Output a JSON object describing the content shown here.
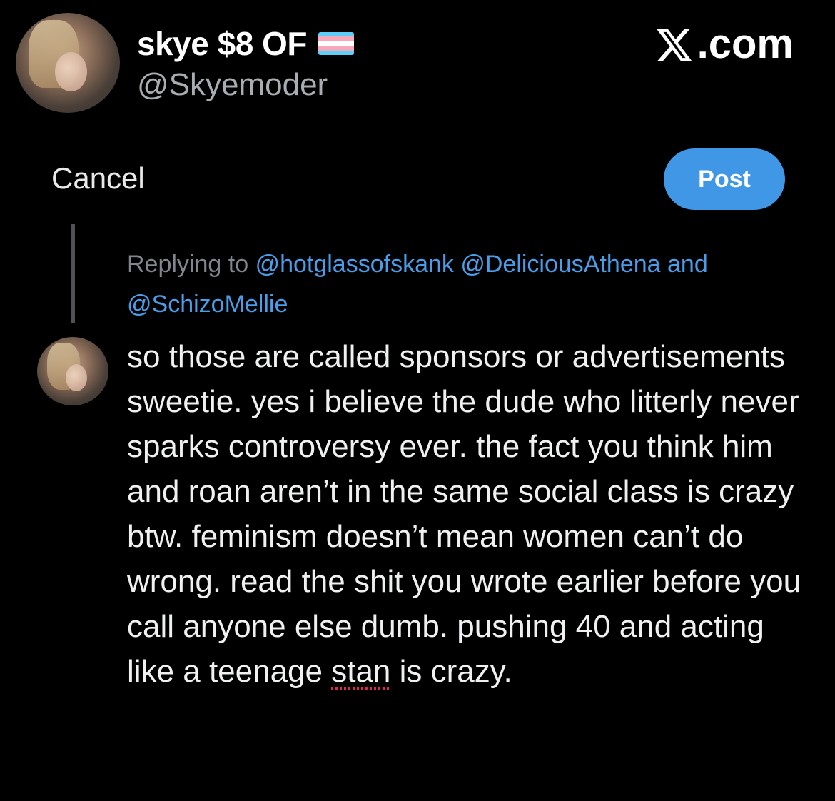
{
  "header": {
    "display_name": "skye $8 OF",
    "handle": "@Skyemoder",
    "site": ".com",
    "flag_colors": [
      "#5BCEFA",
      "#F5A9B8",
      "#FFFFFF",
      "#F5A9B8",
      "#5BCEFA"
    ]
  },
  "composer": {
    "cancel_label": "Cancel",
    "post_label": "Post",
    "post_color": "#3f97e6"
  },
  "reply": {
    "replying_prefix": "Replying to",
    "mention_1": "@hotglassofskank",
    "mention_2": "@DeliciousAthena",
    "conjunction": "and",
    "mention_3": "@SchizoMellie",
    "text_before": "so those are called sponsors or advertisements sweetie. yes i believe the dude who litterly never sparks controversy ever. the fact you think him and roan aren’t in the same social class is crazy btw. feminism doesn’t mean women can’t do wrong. read the shit you wrote earlier before you call anyone else dumb. pushing 40 and acting like a teenage ",
    "spellchecked_word": "stan",
    "text_after": " is crazy."
  }
}
